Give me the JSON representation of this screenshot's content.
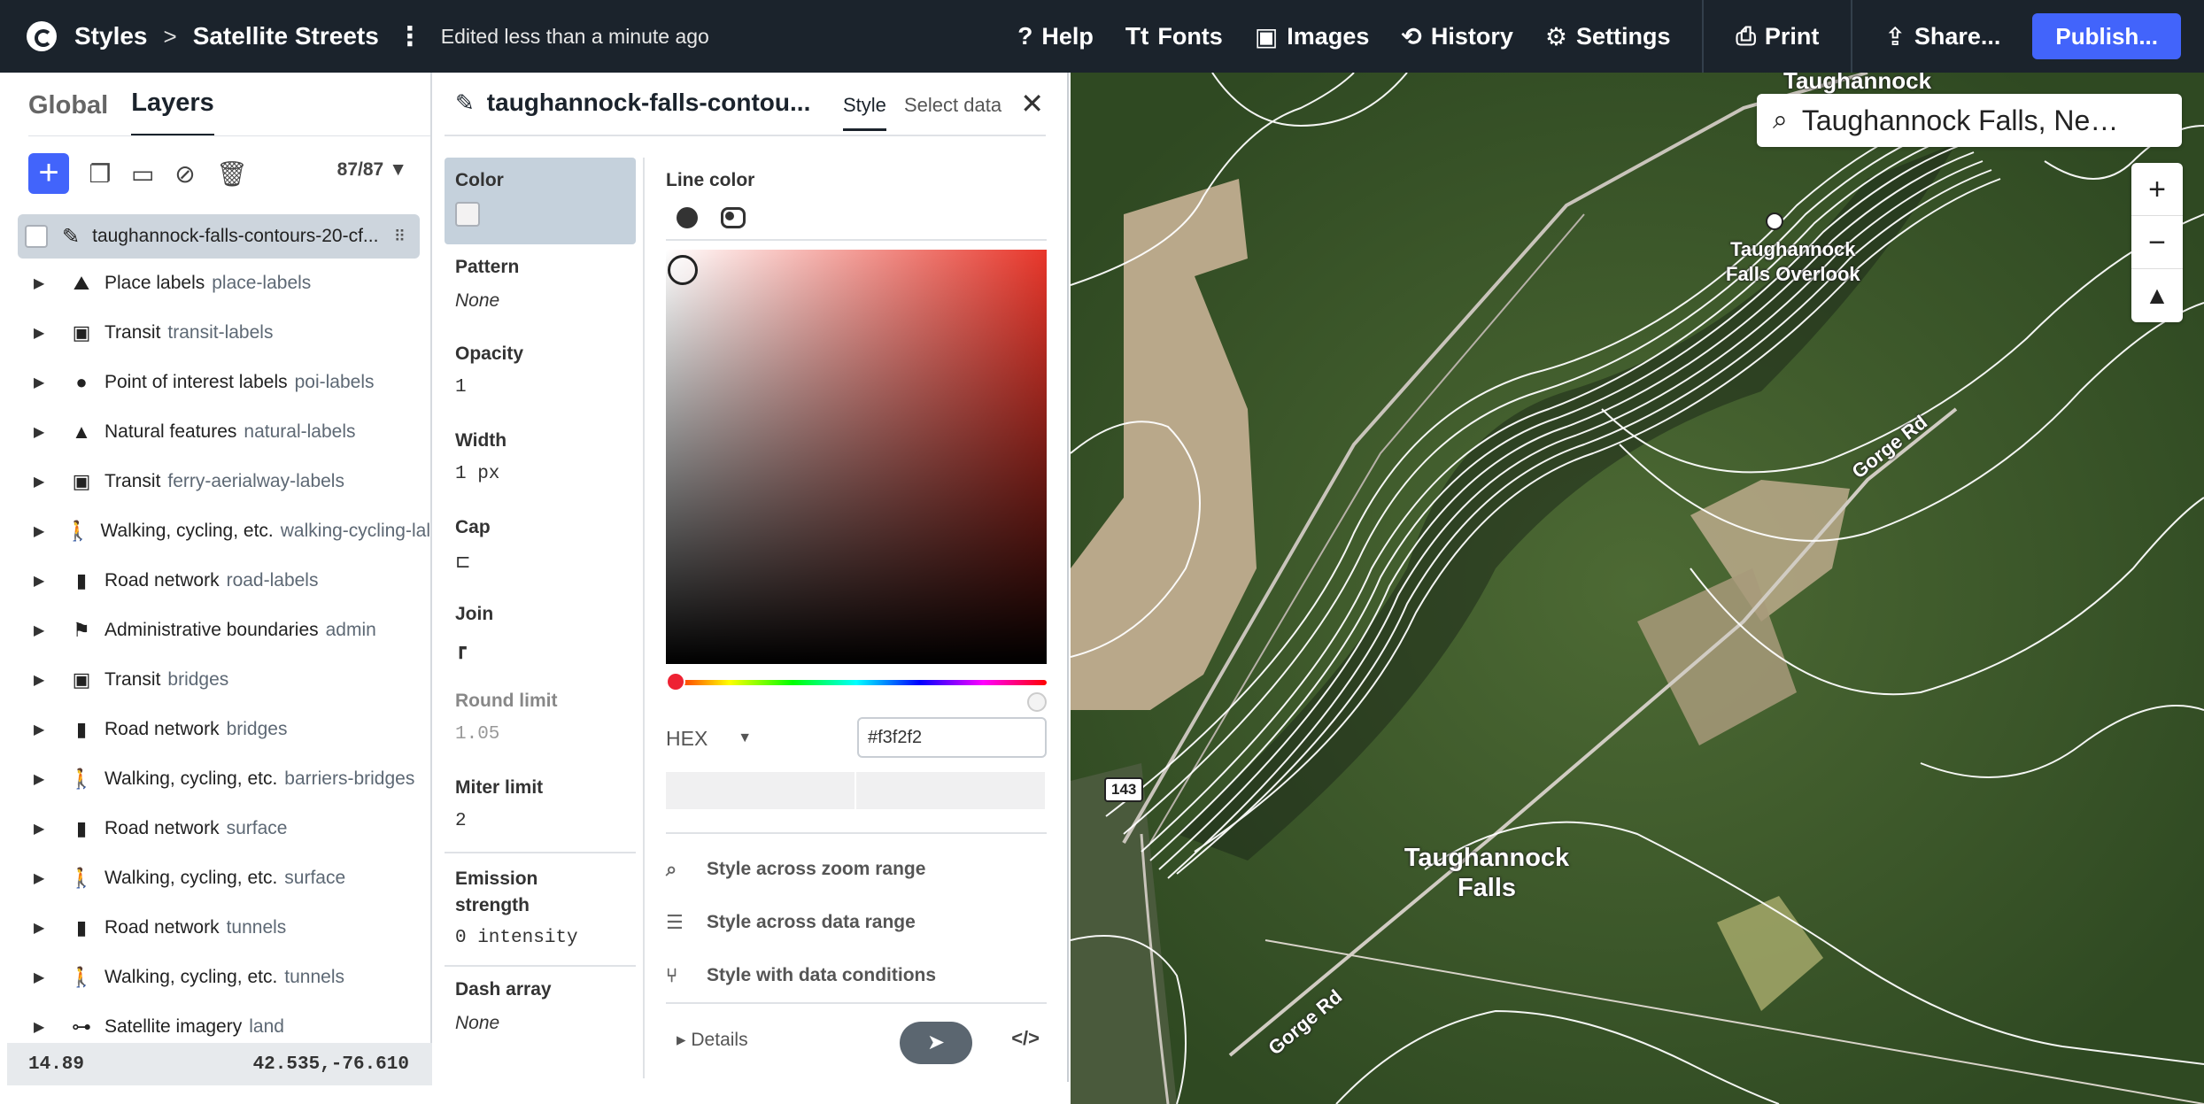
{
  "topbar": {
    "app": "Styles",
    "style_name": "Satellite Streets",
    "edited": "Edited less than a minute ago",
    "menu": [
      {
        "label": "Help",
        "icon": "?"
      },
      {
        "label": "Fonts",
        "icon": "Tt"
      },
      {
        "label": "Images",
        "icon": "▣"
      },
      {
        "label": "History",
        "icon": "⟲"
      },
      {
        "label": "Settings",
        "icon": "⚙"
      }
    ],
    "print": "Print",
    "share": "Share...",
    "publish": "Publish..."
  },
  "left": {
    "tabs": [
      "Global",
      "Layers"
    ],
    "layer_count": "87/87",
    "selected_layer": "taughannock-falls-contours-20-cf...",
    "layers": [
      {
        "name": "Place labels",
        "id": "place-labels",
        "icon": "⛰"
      },
      {
        "name": "Transit",
        "id": "transit-labels",
        "icon": "▣"
      },
      {
        "name": "Point of interest labels",
        "id": "poi-labels",
        "icon": "●"
      },
      {
        "name": "Natural features",
        "id": "natural-labels",
        "icon": "▲"
      },
      {
        "name": "Transit",
        "id": "ferry-aerialway-labels",
        "icon": "▣"
      },
      {
        "name": "Walking, cycling, etc.",
        "id": "walking-cycling-lal",
        "icon": "🚶"
      },
      {
        "name": "Road network",
        "id": "road-labels",
        "icon": "▮"
      },
      {
        "name": "Administrative boundaries",
        "id": "admin",
        "icon": "⚑"
      },
      {
        "name": "Transit",
        "id": "bridges",
        "icon": "▣"
      },
      {
        "name": "Road network",
        "id": "bridges",
        "icon": "▮"
      },
      {
        "name": "Walking, cycling, etc.",
        "id": "barriers-bridges",
        "icon": "🚶"
      },
      {
        "name": "Road network",
        "id": "surface",
        "icon": "▮"
      },
      {
        "name": "Walking, cycling, etc.",
        "id": "surface",
        "icon": "🚶"
      },
      {
        "name": "Road network",
        "id": "tunnels",
        "icon": "▮"
      },
      {
        "name": "Walking, cycling, etc.",
        "id": "tunnels",
        "icon": "🚶"
      },
      {
        "name": "Satellite imagery",
        "id": "land",
        "icon": "⊶"
      }
    ],
    "zoom": "14.89",
    "coords": "42.535,-76.610"
  },
  "props": {
    "title": "taughannock-falls-contou...",
    "tabs": [
      "Style",
      "Select data"
    ],
    "properties": [
      {
        "label": "Color",
        "value": "",
        "kind": "swatch"
      },
      {
        "label": "Pattern",
        "value": "None",
        "kind": "italic"
      },
      {
        "label": "Opacity",
        "value": "1",
        "kind": "plain"
      },
      {
        "label": "Width",
        "value": "1 px",
        "kind": "plain"
      },
      {
        "label": "Cap",
        "value": "",
        "kind": "cap"
      },
      {
        "label": "Join",
        "value": "",
        "kind": "join"
      },
      {
        "label": "Round limit",
        "value": "1.05",
        "kind": "dim"
      },
      {
        "label": "Miter limit",
        "value": "2",
        "kind": "plain"
      },
      {
        "label": "Emission strength",
        "value": "0 intensity",
        "kind": "mono"
      },
      {
        "label": "Dash array",
        "value": "None",
        "kind": "italic"
      }
    ],
    "editor": {
      "label": "Line color",
      "hex_mode": "HEX",
      "hex_value": "#f3f2f2",
      "style_options": [
        "Style across zoom range",
        "Style across data range",
        "Style with data conditions"
      ],
      "details": "Details"
    }
  },
  "map": {
    "search": "Taughannock Falls, New ...",
    "labels": [
      {
        "text": "Taughannock\nFalls Overlook"
      },
      {
        "text": "Taughannock\nFalls"
      },
      {
        "text": "Gorge Rd"
      },
      {
        "text": "Gorge Rd"
      },
      {
        "text": "Taughannock"
      }
    ],
    "route_shield": "143"
  }
}
